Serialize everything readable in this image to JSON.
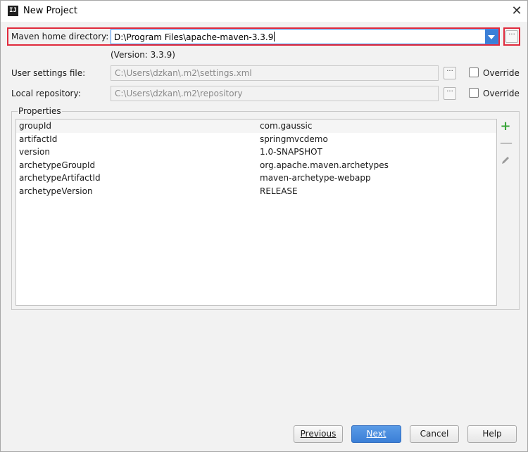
{
  "window": {
    "title": "New Project",
    "app_icon_text": "IJ"
  },
  "maven_home": {
    "label": "Maven home directory:",
    "value": "D:\\Program Files\\apache-maven-3.3.9",
    "version": "(Version: 3.3.9)"
  },
  "user_settings": {
    "label": "User settings file:",
    "value": "C:\\Users\\dzkan\\.m2\\settings.xml",
    "override_label": "Override"
  },
  "local_repo": {
    "label": "Local repository:",
    "value": "C:\\Users\\dzkan\\.m2\\repository",
    "override_label": "Override"
  },
  "properties": {
    "title": "Properties",
    "rows": [
      {
        "key": "groupId",
        "value": "com.gaussic"
      },
      {
        "key": "artifactId",
        "value": "springmvcdemo"
      },
      {
        "key": "version",
        "value": "1.0-SNAPSHOT"
      },
      {
        "key": "archetypeGroupId",
        "value": "org.apache.maven.archetypes"
      },
      {
        "key": "archetypeArtifactId",
        "value": "maven-archetype-webapp"
      },
      {
        "key": "archetypeVersion",
        "value": "RELEASE"
      }
    ]
  },
  "buttons": {
    "previous": "Previous",
    "next": "Next",
    "cancel": "Cancel",
    "help": "Help"
  },
  "icons": {
    "close": "close-icon",
    "browse": "ellipsis-icon",
    "add": "plus-icon",
    "remove": "minus-icon",
    "edit": "pencil-icon"
  },
  "colors": {
    "highlight": "#e02a3c",
    "primary": "#3b7fd7",
    "add": "#3aa53a"
  }
}
